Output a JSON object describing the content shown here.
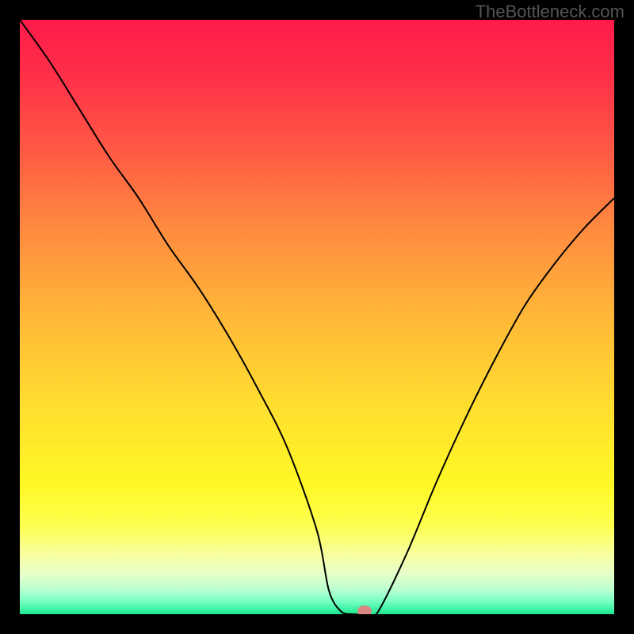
{
  "watermark": "TheBottleneck.com",
  "chart_data": {
    "type": "line",
    "title": "",
    "xlabel": "",
    "ylabel": "",
    "xlim": [
      0,
      100
    ],
    "ylim": [
      0,
      100
    ],
    "x": [
      0,
      5,
      10,
      15,
      20,
      25,
      30,
      35,
      40,
      45,
      50,
      52,
      54,
      56,
      58,
      60,
      65,
      70,
      75,
      80,
      85,
      90,
      95,
      100
    ],
    "values": [
      100,
      93,
      85,
      77,
      70,
      62,
      55,
      47,
      38,
      28,
      14,
      4,
      0.5,
      0,
      0,
      0,
      10,
      22,
      33,
      43,
      52,
      59,
      65,
      70
    ],
    "marker_point": {
      "x": 58,
      "y": 0
    },
    "background": "rainbow-vertical-gradient",
    "grid": false
  }
}
